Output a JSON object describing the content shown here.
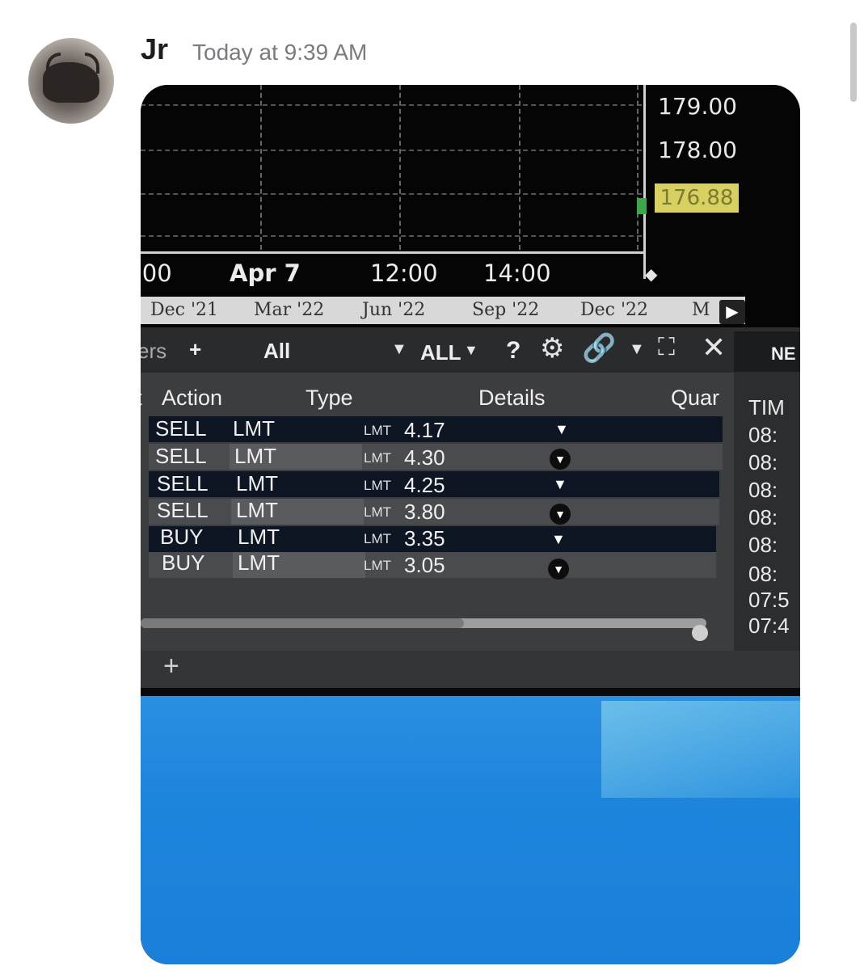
{
  "message": {
    "username": "Jr",
    "timestamp": "Today at 9:39 AM"
  },
  "chart": {
    "prices": [
      "179.00",
      "178.00"
    ],
    "last_price": "176.88",
    "times": [
      ":00",
      "Apr 7",
      "12:00",
      "14:00"
    ],
    "range_strip": [
      "Dec '21",
      "Mar '22",
      "Jun '22",
      "Sep '22",
      "Dec '22",
      "M"
    ]
  },
  "orders_panel": {
    "tabs": {
      "partial": "ers",
      "plus": "+",
      "all": "All",
      "filter": "ALL",
      "help": "?"
    },
    "columns": {
      "action": "Action",
      "type": "Type",
      "details": "Details",
      "quantity": "Quar",
      "partial": "t"
    },
    "rows": [
      {
        "action": "SELL",
        "type": "LMT",
        "detail_prefix": "LMT",
        "detail_price": "4.17"
      },
      {
        "action": "SELL",
        "type": "LMT",
        "detail_prefix": "LMT",
        "detail_price": "4.30"
      },
      {
        "action": "SELL",
        "type": "LMT",
        "detail_prefix": "LMT",
        "detail_price": "4.25"
      },
      {
        "action": "SELL",
        "type": "LMT",
        "detail_prefix": "LMT",
        "detail_price": "3.80"
      },
      {
        "action": "BUY",
        "type": "LMT",
        "detail_prefix": "LMT",
        "detail_price": "3.35"
      },
      {
        "action": "BUY",
        "type": "LMT",
        "detail_prefix": "LMT",
        "detail_price": "3.05"
      }
    ],
    "bottom_plus": "+"
  },
  "news_panel": {
    "title": "NE",
    "column": "TIM",
    "times": [
      "08:",
      "08:",
      "08:",
      "08:",
      "08:",
      "08:",
      "07:5",
      "07:4"
    ]
  },
  "icons": {
    "gear": "gear-icon",
    "link": "link-icon",
    "expand": "expand-icon",
    "close": "close-icon"
  },
  "colors": {
    "last_price_bg": "#d8d060",
    "link_icon": "#e0463c",
    "desktop": "#1d84dc"
  }
}
